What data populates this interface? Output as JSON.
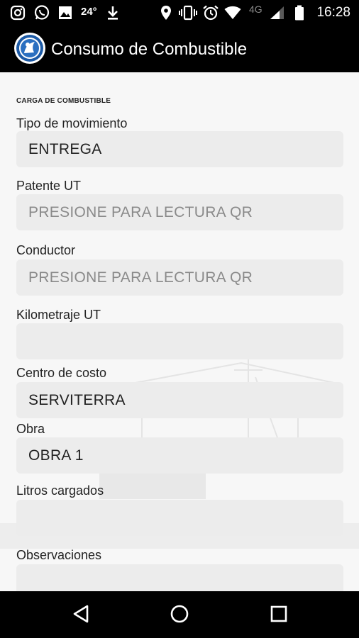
{
  "status_bar": {
    "icons": [
      "instagram-icon",
      "whatsapp-icon",
      "gallery-icon",
      "download-icon",
      "location-icon",
      "vibrate-icon",
      "alarm-icon",
      "wifi-icon",
      "signal-icon",
      "battery-icon"
    ],
    "temperature": "24°",
    "network": "4G",
    "time": "16:28"
  },
  "app_bar": {
    "title": "Consumo de Combustible"
  },
  "form": {
    "section_title": "CARGA DE COMBUSTIBLE",
    "fields": [
      {
        "label": "Tipo de movimiento",
        "value": "ENTREGA",
        "placeholder": ""
      },
      {
        "label": "Patente UT",
        "value": "",
        "placeholder": "PRESIONE PARA LECTURA QR"
      },
      {
        "label": "Conductor",
        "value": "",
        "placeholder": "PRESIONE PARA LECTURA QR"
      },
      {
        "label": "Kilometraje UT",
        "value": "",
        "placeholder": ""
      },
      {
        "label": "Centro de costo",
        "value": "SERVITERRA",
        "placeholder": ""
      },
      {
        "label": "Obra",
        "value": "OBRA 1",
        "placeholder": ""
      },
      {
        "label": "Litros cargados",
        "value": "",
        "placeholder": ""
      },
      {
        "label": "Observaciones",
        "value": "",
        "placeholder": ""
      }
    ]
  },
  "nav_bar": {
    "buttons": [
      "back-icon",
      "home-icon",
      "recents-icon"
    ]
  },
  "colors": {
    "app_bar": "#000000",
    "content_bg": "#f7f7f7",
    "field_bg": "#ececec",
    "placeholder_text": "#8a8a8a"
  }
}
